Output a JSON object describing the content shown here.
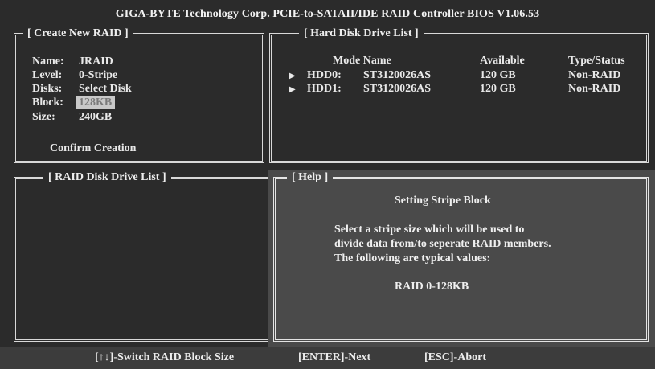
{
  "title": "GIGA-BYTE Technology Corp. PCIE-to-SATAII/IDE RAID Controller BIOS V1.06.53",
  "create_panel": {
    "title": "[ Create New RAID ]",
    "fields": [
      {
        "label": "Name:",
        "value": "JRAID"
      },
      {
        "label": "Level:",
        "value": "0-Stripe"
      },
      {
        "label": "Disks:",
        "value": "Select Disk"
      },
      {
        "label": "Block:",
        "value": "128KB"
      },
      {
        "label": "Size:",
        "value": "240GB"
      }
    ],
    "confirm": "Confirm Creation"
  },
  "hdd_panel": {
    "title": "[ Hard Disk Drive List ]",
    "headers": {
      "mode_name": "Mode Name",
      "available": "Available",
      "type_status": "Type/Status"
    },
    "rows": [
      {
        "mode": "HDD0:",
        "name": "ST3120026AS",
        "available": "120 GB",
        "status": "Non-RAID"
      },
      {
        "mode": "HDD1:",
        "name": "ST3120026AS",
        "available": "120 GB",
        "status": "Non-RAID"
      }
    ]
  },
  "raid_panel": {
    "title": "[ RAID Disk Drive List ]"
  },
  "help_panel": {
    "title": "[ Help ]",
    "heading": "Setting Stripe Block",
    "lines": [
      "Select a stripe size which will be used to",
      "divide data from/to seperate RAID members.",
      "The following are typical values:"
    ],
    "value": "RAID 0-128KB"
  },
  "footer": {
    "switch": "[↑↓]-Switch RAID Block Size",
    "next": "[ENTER]-Next",
    "abort": "[ESC]-Abort"
  },
  "icons": {
    "row_marker": "triangle-right-icon"
  }
}
